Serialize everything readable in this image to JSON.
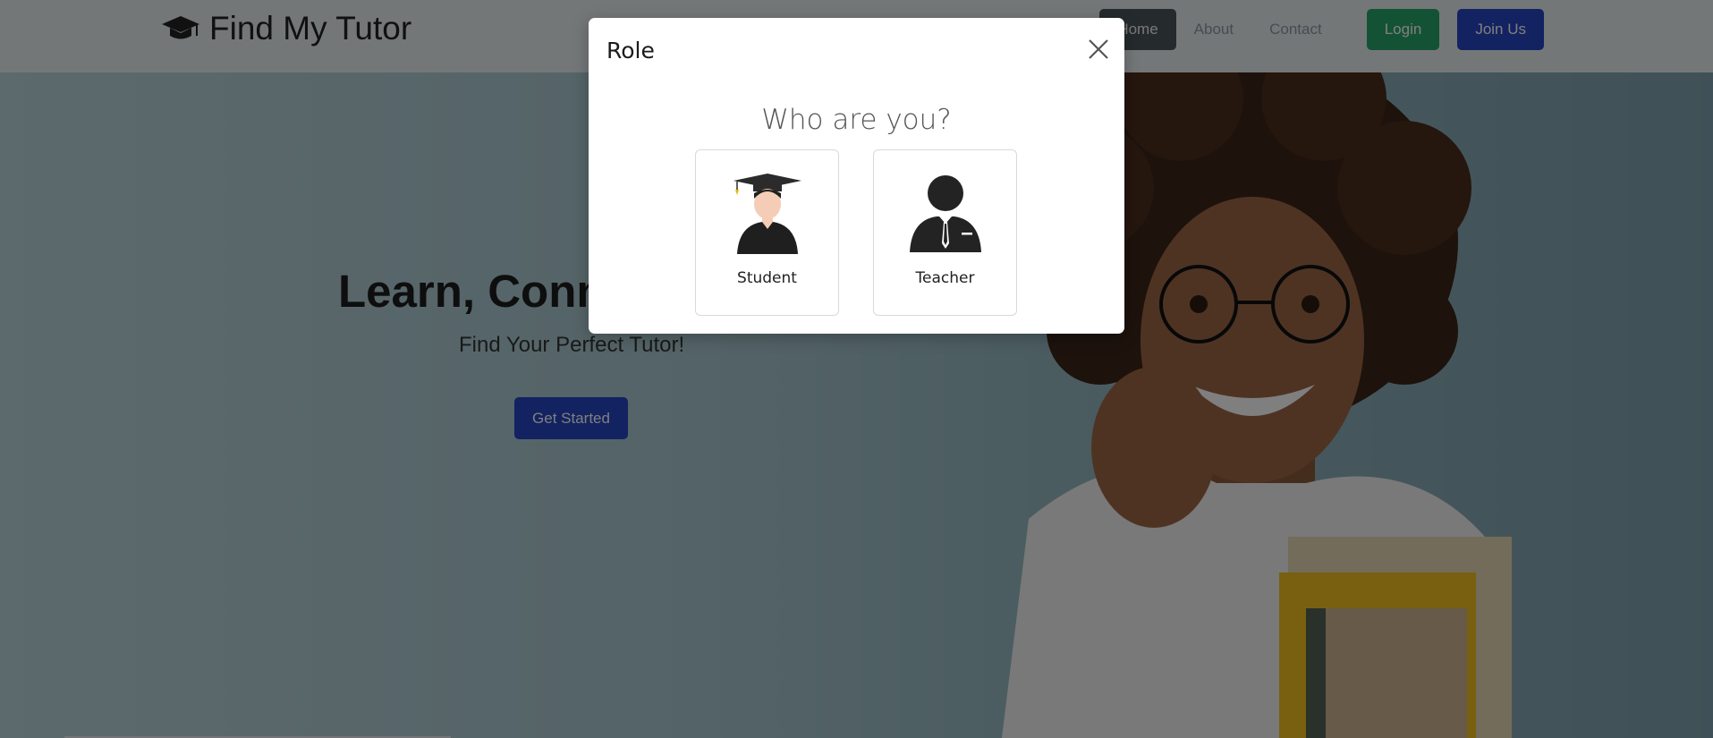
{
  "navbar": {
    "brand": "Find My Tutor",
    "brand_icon": "graduation-cap-icon",
    "links": [
      "Home",
      "About",
      "Contact"
    ],
    "active_link": "Home",
    "login_label": "Login",
    "join_label": "Join Us"
  },
  "hero": {
    "title": "Learn, Connect",
    "subtitle": "Find Your Perfect Tutor!",
    "cta_label": "Get Started"
  },
  "modal": {
    "title": "Role",
    "close_icon": "close-icon",
    "question": "Who are you?",
    "roles": [
      {
        "label": "Student",
        "icon": "student-graduate-icon"
      },
      {
        "label": "Teacher",
        "icon": "teacher-icon"
      }
    ]
  },
  "colors": {
    "login": "#28a46b",
    "primary": "#2744c2",
    "nav_active": "#4b5459"
  }
}
